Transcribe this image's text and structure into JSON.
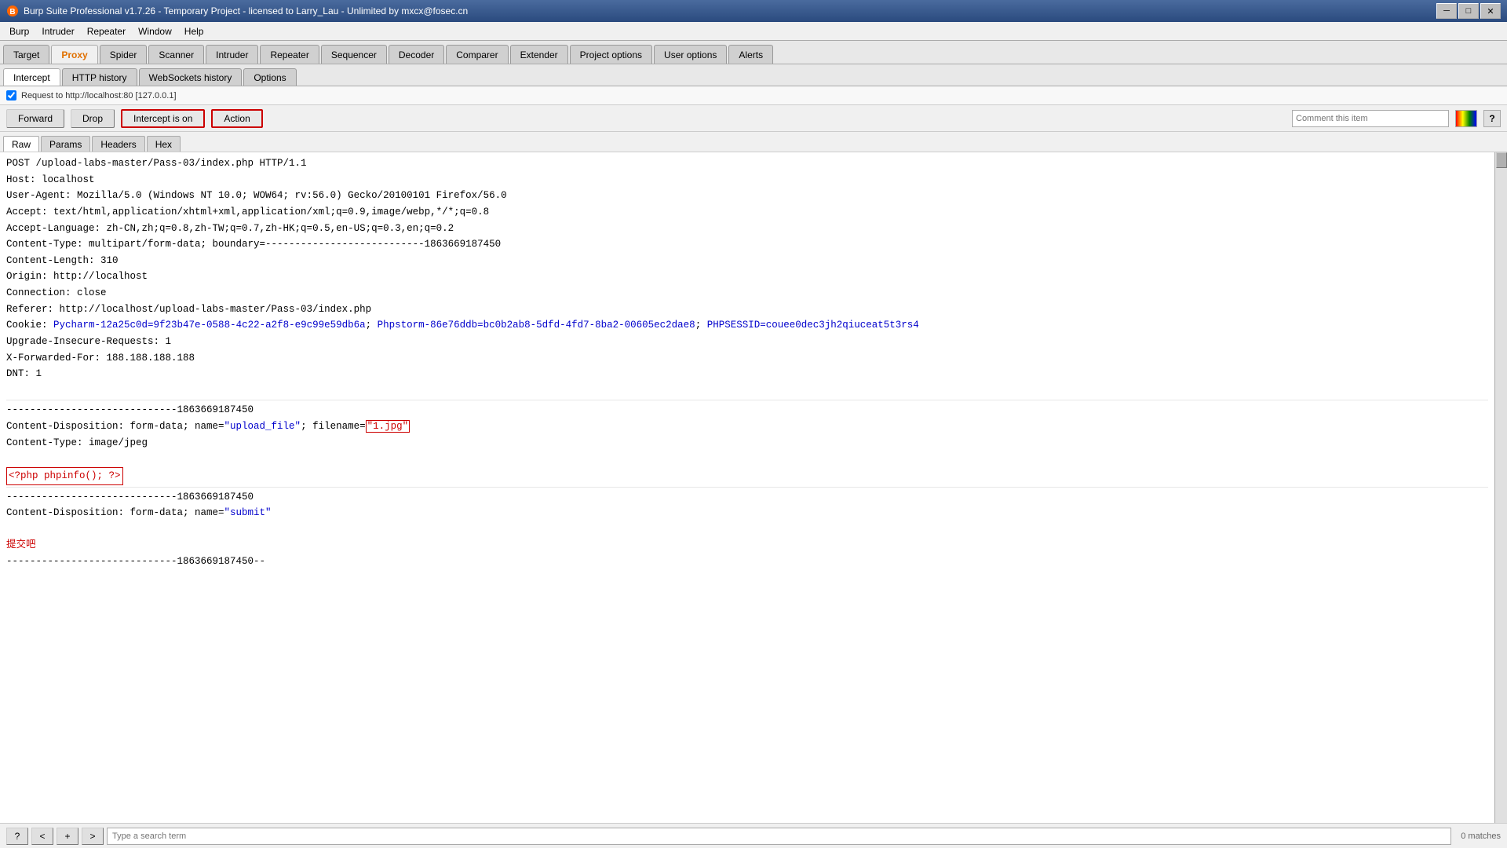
{
  "titlebar": {
    "title": "Burp Suite Professional v1.7.26 - Temporary Project - licensed to Larry_Lau - Unlimited by mxcx@fosec.cn",
    "minimize_label": "─",
    "maximize_label": "□",
    "close_label": "✕"
  },
  "menubar": {
    "items": [
      "Burp",
      "Intruder",
      "Repeater",
      "Window",
      "Help"
    ]
  },
  "main_tabs": {
    "items": [
      "Target",
      "Proxy",
      "Spider",
      "Scanner",
      "Intruder",
      "Repeater",
      "Sequencer",
      "Decoder",
      "Comparer",
      "Extender",
      "Project options",
      "User options",
      "Alerts"
    ],
    "active": "Proxy"
  },
  "sub_tabs": {
    "items": [
      "Intercept",
      "HTTP history",
      "WebSockets history",
      "Options"
    ],
    "active": "Intercept"
  },
  "request_info": {
    "label": "Request to http://localhost:80 [127.0.0.1]"
  },
  "toolbar": {
    "forward_label": "Forward",
    "drop_label": "Drop",
    "intercept_on_label": "Intercept is on",
    "action_label": "Action",
    "comment_placeholder": "Comment this item"
  },
  "content_tabs": {
    "items": [
      "Raw",
      "Params",
      "Headers",
      "Hex"
    ],
    "active": "Raw"
  },
  "http_content": {
    "line1": "POST /upload-labs-master/Pass-03/index.php HTTP/1.1",
    "line2": "Host: localhost",
    "line3": "User-Agent: Mozilla/5.0 (Windows NT 10.0; WOW64; rv:56.0) Gecko/20100101 Firefox/56.0",
    "line4": "Accept: text/html,application/xhtml+xml,application/xml;q=0.9,image/webp,*/*;q=0.8",
    "line5": "Accept-Language: zh-CN,zh;q=0.8,zh-TW;q=0.7,zh-HK;q=0.5,en-US;q=0.3,en;q=0.2",
    "line6": "Content-Type: multipart/form-data; boundary=---------------------------1863669187450",
    "line7": "Content-Length: 310",
    "line8": "Origin: http://localhost",
    "line9": "Connection: close",
    "line10": "Referer: http://localhost/upload-labs-master/Pass-03/index.php",
    "cookie_prefix": "Cookie: ",
    "cookie1_name": "Pycharm-12a25c0d",
    "cookie1_value": "=9f23b47e-0588-4c22-a2f8-e9c99e59db6a",
    "cookie2_name": "Phpstorm-86e76ddb",
    "cookie2_value": "=bc0b2ab8-5dfd-4fd7-8ba2-00605ec2dae8",
    "cookie3_name": "PHPSESSID",
    "cookie3_value": "=couee0dec3jh2qiuceat5t3rs4",
    "line12": "Upgrade-Insecure-Requests: 1",
    "line13": "X-Forwarded-For: 188.188.188.188",
    "line14": "DNT: 1",
    "boundary1": "-----------------------------1863669187450",
    "content_disp1": "Content-Disposition: form-data; name=\"upload_file\"; filename=\"",
    "filename_value": "1.jpg",
    "content_disp1_end": "\"",
    "content_type1": "Content-Type: image/jpeg",
    "php_code": "<?php phpinfo(); ?>",
    "boundary2": "-----------------------------1863669187450",
    "content_disp2": "Content-Disposition: form-data; name=\"submit\"",
    "chinese_text": "提交吧",
    "boundary3": "-----------------------------1863669187450--"
  },
  "bottom_bar": {
    "help_label": "?",
    "prev_label": "<",
    "next_label": ">",
    "add_label": "+",
    "search_placeholder": "Type a search term",
    "match_count": "0 matches"
  }
}
